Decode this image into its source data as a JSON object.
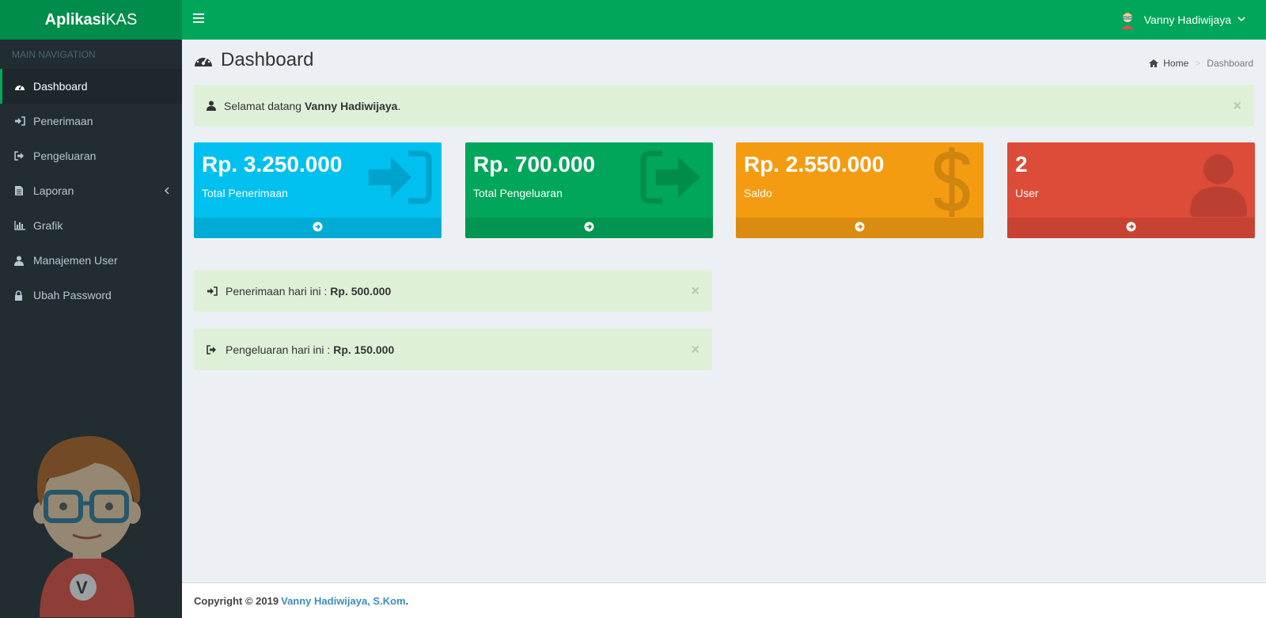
{
  "app": {
    "logo_bold": "Aplikasi",
    "logo_light": "KAS"
  },
  "header": {
    "user_name": "Vanny Hadiwijaya"
  },
  "sidebar": {
    "section_title": "MAIN NAVIGATION",
    "items": [
      {
        "label": "Dashboard",
        "icon": "dashboard-icon"
      },
      {
        "label": "Penerimaan",
        "icon": "sign-in-icon"
      },
      {
        "label": "Pengeluaran",
        "icon": "sign-out-icon"
      },
      {
        "label": "Laporan",
        "icon": "file-text-icon"
      },
      {
        "label": "Grafik",
        "icon": "bar-chart-icon"
      },
      {
        "label": "Manajemen User",
        "icon": "user-icon"
      },
      {
        "label": "Ubah Password",
        "icon": "lock-icon"
      }
    ],
    "mascot_badge": "V"
  },
  "page": {
    "title": "Dashboard",
    "breadcrumb": {
      "home": "Home",
      "current": "Dashboard"
    }
  },
  "welcome": {
    "prefix": "Selamat datang ",
    "name": "Vanny Hadiwijaya",
    "suffix": "."
  },
  "boxes": [
    {
      "amount": "Rp. 3.250.000",
      "label": "Total Penerimaan",
      "color": "#00c0ef",
      "icon_color": "#00a3cb",
      "icon": "sign-in-icon"
    },
    {
      "amount": "Rp. 700.000",
      "label": "Total Pengeluaran",
      "color": "#00a65a",
      "icon_color": "#008d4c",
      "icon": "sign-out-icon"
    },
    {
      "amount": "Rp. 2.550.000",
      "label": "Saldo",
      "color": "#f39c12",
      "icon_color": "#cf850f",
      "icon": "dollar-icon"
    },
    {
      "amount": "2",
      "label": "User",
      "color": "#dd4b39",
      "icon_color": "#bc4031",
      "icon": "user-icon"
    }
  ],
  "today": {
    "income_prefix": "Penerimaan hari ini : ",
    "income_value": "Rp. 500.000",
    "expense_prefix": "Pengeluaran hari ini : ",
    "expense_value": "Rp. 150.000"
  },
  "footer": {
    "prefix": "Copyright © 2019",
    "author": "Vanny Hadiwijaya, S.Kom",
    "suffix": "."
  },
  "close_symbol": "×"
}
